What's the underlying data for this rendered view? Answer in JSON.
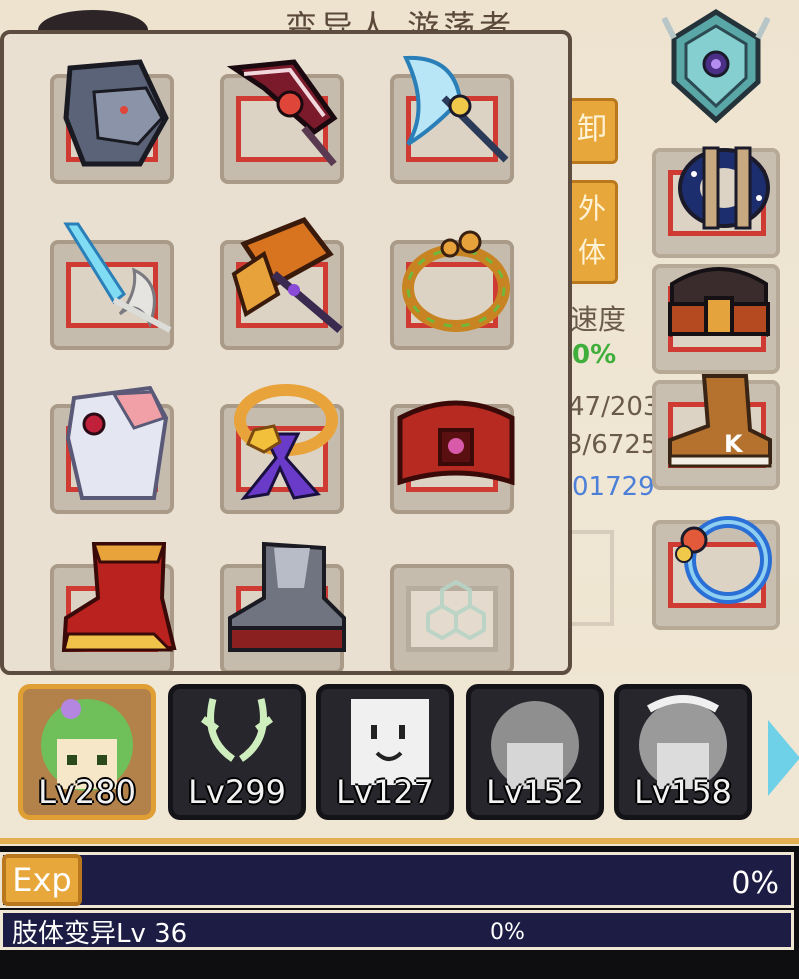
{
  "background": {
    "title": "变异人 游荡者",
    "button_unequip": "卸",
    "button_outer": "外\n体",
    "stat_label": "速度",
    "stat_green": "0%",
    "stat_line1": "47/203",
    "stat_line2": "3/6725",
    "stat_blue": "01729"
  },
  "equipment_panel": {
    "slots": [
      {
        "name": "wolf-shield",
        "empty": false
      },
      {
        "name": "crimson-scepter",
        "empty": false
      },
      {
        "name": "ice-axe",
        "empty": false
      },
      {
        "name": "ice-blade",
        "empty": false
      },
      {
        "name": "flame-hammer",
        "empty": false
      },
      {
        "name": "vine-ring",
        "empty": false
      },
      {
        "name": "crystal-gauntlet",
        "empty": false
      },
      {
        "name": "star-collar",
        "empty": false
      },
      {
        "name": "crimson-belt",
        "empty": false
      },
      {
        "name": "flame-boot",
        "empty": false
      },
      {
        "name": "iron-boot",
        "empty": false
      },
      {
        "name": "empty-slot",
        "empty": true
      }
    ]
  },
  "equipped": [
    {
      "name": "crest-emblem"
    },
    {
      "name": "starry-bracer"
    },
    {
      "name": "leather-belt"
    },
    {
      "name": "k-sneaker"
    },
    {
      "name": "azure-ring"
    }
  ],
  "characters": [
    {
      "level": "Lv280",
      "selected": true,
      "color": "#7fc46a"
    },
    {
      "level": "Lv299",
      "selected": false,
      "color": "#d8f0c8"
    },
    {
      "level": "Lv127",
      "selected": false,
      "color": "#f0f0f0"
    },
    {
      "level": "Lv152",
      "selected": false,
      "color": "#bdbdbd"
    },
    {
      "level": "Lv158",
      "selected": false,
      "color": "#c9c9c9"
    }
  ],
  "exp": {
    "label": "Exp",
    "percent": "0%"
  },
  "skill": {
    "label": "肢体变异Lv 36",
    "percent": "0%"
  }
}
